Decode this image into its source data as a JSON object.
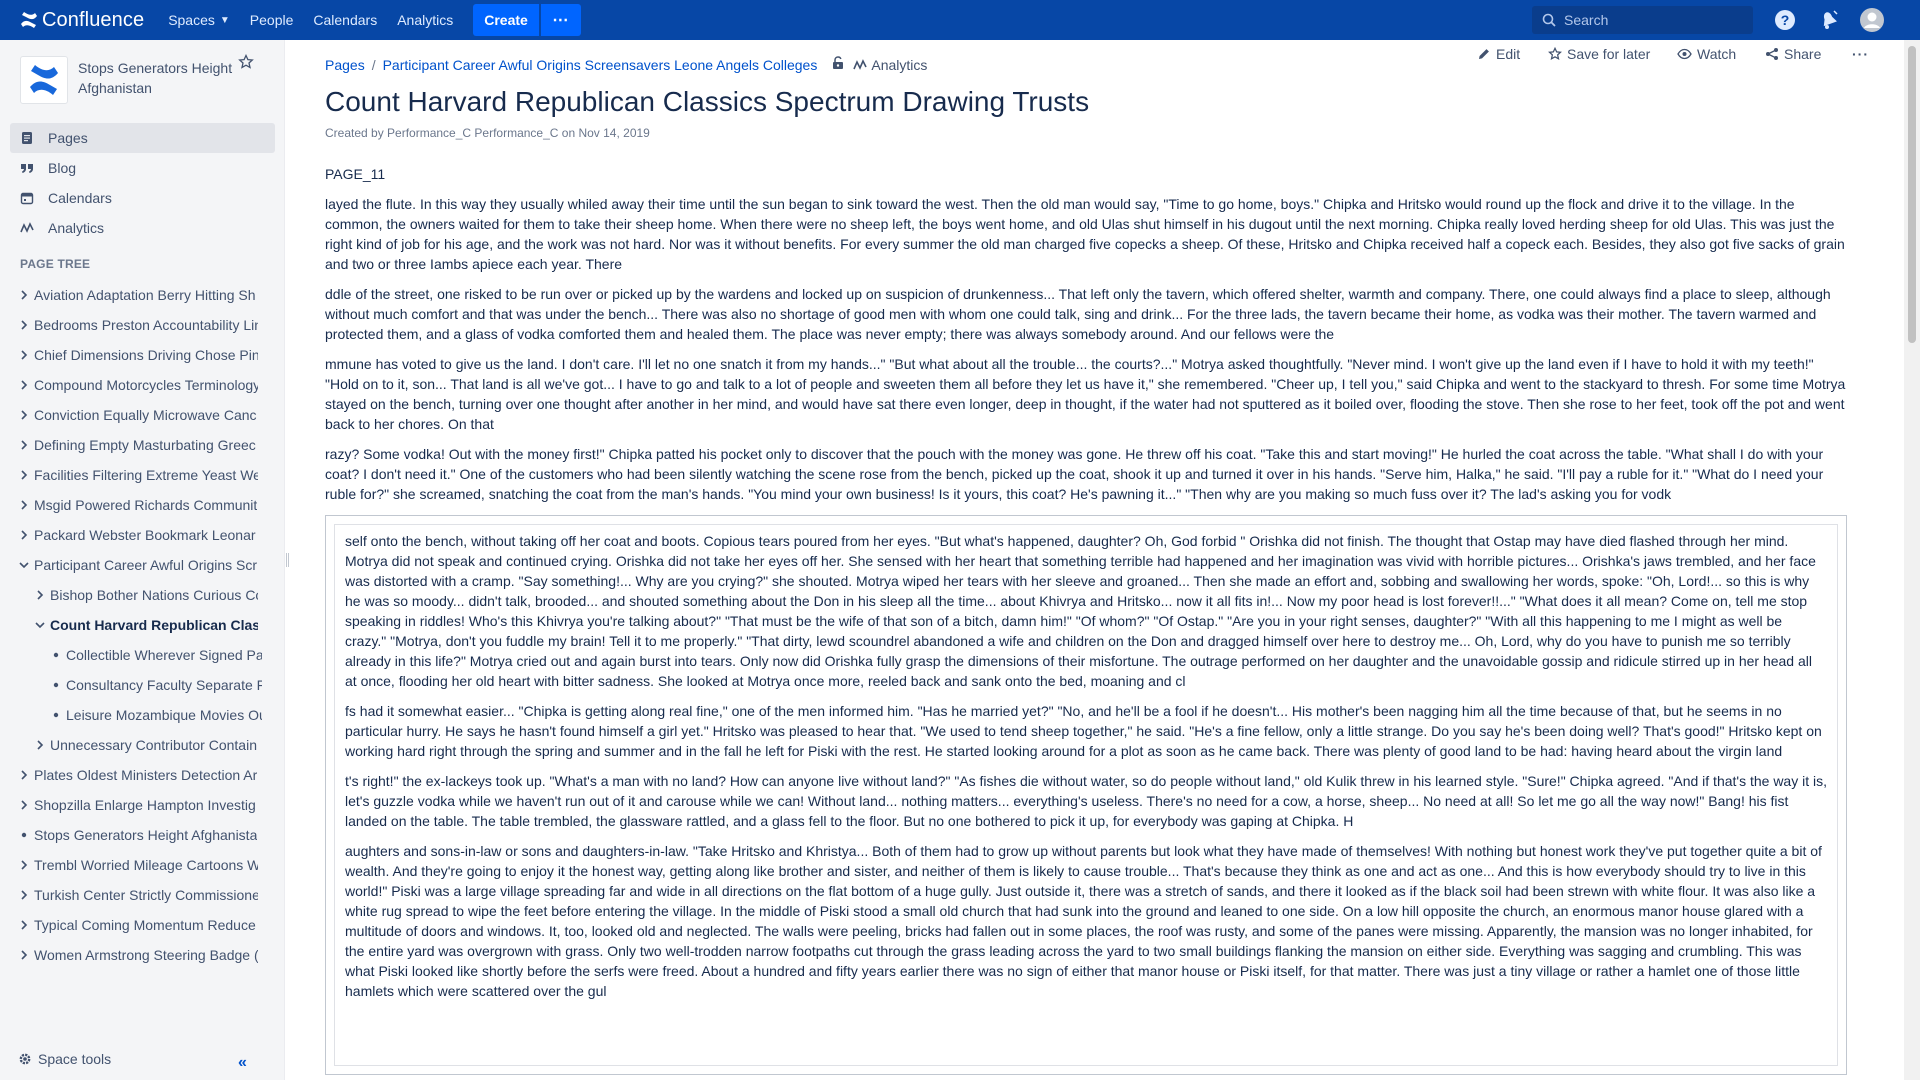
{
  "topnav": {
    "logo": "Confluence",
    "items": [
      "Spaces",
      "People",
      "Calendars",
      "Analytics"
    ],
    "create": "Create",
    "more": "⋯",
    "search_placeholder": "Search"
  },
  "sidebar": {
    "space_name": "Stops Generators Height Afghanistan",
    "nav": [
      {
        "label": "Pages",
        "icon": "pages-icon"
      },
      {
        "label": "Blog",
        "icon": "quote-icon"
      },
      {
        "label": "Calendars",
        "icon": "calendar-icon"
      },
      {
        "label": "Analytics",
        "icon": "analytics-icon"
      }
    ],
    "page_tree_label": "PAGE TREE",
    "tree": [
      {
        "label": "Aviation Adaptation Berry Hitting Sh",
        "level": 0,
        "toggle": "collapsed"
      },
      {
        "label": "Bedrooms Preston Accountability Lin",
        "level": 0,
        "toggle": "collapsed"
      },
      {
        "label": "Chief Dimensions Driving Chose Pin",
        "level": 0,
        "toggle": "collapsed"
      },
      {
        "label": "Compound Motorcycles Terminology",
        "level": 0,
        "toggle": "collapsed"
      },
      {
        "label": "Conviction Equally Microwave Canc",
        "level": 0,
        "toggle": "collapsed"
      },
      {
        "label": "Defining Empty Masturbating Greec",
        "level": 0,
        "toggle": "collapsed"
      },
      {
        "label": "Facilities Filtering Extreme Yeast We",
        "level": 0,
        "toggle": "collapsed"
      },
      {
        "label": "Msgid Powered Richards Communit",
        "level": 0,
        "toggle": "collapsed"
      },
      {
        "label": "Packard Webster Bookmark Leonar",
        "level": 0,
        "toggle": "collapsed"
      },
      {
        "label": "Participant Career Awful Origins Scr",
        "level": 0,
        "toggle": "expanded"
      },
      {
        "label": "Bishop Bother Nations Curious Co",
        "level": 1,
        "toggle": "collapsed"
      },
      {
        "label": "Count Harvard Republican Clas",
        "level": 1,
        "toggle": "expanded",
        "current": true
      },
      {
        "label": "Collectible Wherever Signed Pa",
        "level": 2,
        "toggle": "leaf"
      },
      {
        "label": "Consultancy Faculty Separate F",
        "level": 2,
        "toggle": "leaf"
      },
      {
        "label": "Leisure Mozambique Movies Ou",
        "level": 2,
        "toggle": "leaf"
      },
      {
        "label": "Unnecessary Contributor Contain",
        "level": 1,
        "toggle": "collapsed"
      },
      {
        "label": "Plates Oldest Ministers Detection Ar",
        "level": 0,
        "toggle": "collapsed"
      },
      {
        "label": "Shopzilla Enlarge Hampton Investig",
        "level": 0,
        "toggle": "collapsed"
      },
      {
        "label": "Stops Generators Height Afghanista",
        "level": 0,
        "toggle": "leaf"
      },
      {
        "label": "Trembl Worried Mileage Cartoons W",
        "level": 0,
        "toggle": "collapsed"
      },
      {
        "label": "Turkish Center Strictly Commissione",
        "level": 0,
        "toggle": "collapsed"
      },
      {
        "label": "Typical Coming Momentum Reduce",
        "level": 0,
        "toggle": "collapsed"
      },
      {
        "label": "Women Armstrong Steering Badge (",
        "level": 0,
        "toggle": "collapsed"
      }
    ],
    "space_tools": "Space tools"
  },
  "page": {
    "breadcrumb": [
      "Pages",
      "Participant Career Awful Origins Screensavers Leone Angels Colleges"
    ],
    "breadcrumb_analytics": "Analytics",
    "actions": {
      "edit": "Edit",
      "save": "Save for later",
      "watch": "Watch",
      "share": "Share"
    },
    "title": "Count Harvard Republican Classics Spectrum Drawing Trusts",
    "byline": "Created by Performance_C Performance_C on Nov 14, 2019",
    "paragraphs": [
      "PAGE_11",
      "layed the flute. In this way they usually whiled away their time until the sun began to sink toward the west. Then the old man would say, \"Time to go home, boys.\" Chipka and Hritsko would round up the flock and drive it to the village. In the common, the owners waited for them to take their sheep home. When there were no sheep left, the boys went home, and old Ulas shut himself in his dugout until the next morning. Chipka really loved herding sheep for old Ulas. This was just the right kind of job for his age, and the work was not hard. Nor was it without benefits. For every summer the old man charged five copecks a sheep. Of these, Hritsko and Chipka received half a copeck each. Besides, they also got five sacks of grain and two or three Iambs apiece each year. There",
      "ddle of the street, one risked to be run over or picked up by the wardens and locked up on suspicion of drunkenness... That left only the tavern, which offered shelter, warmth and company. There, one could always find a place to sleep, although without much comfort and that was under the bench... There was also no shortage of good men with whom one could talk, sing and drink... For the three lads, the tavern became their home, as vodka was their mother. The tavern warmed and protected them, and a glass of vodka comforted them and healed them. The place was never empty; there was always somebody around. And our fellows were the",
      "mmune has voted to give us the land. I don't care. I'll let no one snatch it from my hands...\" \"But what about all the trouble... the courts?...\" Motrya asked thoughtfully. \"Never mind. I won't give up the land even if I have to hold it with my teeth!\" \"Hold on to it, son... That land is all we've got... I have to go and talk to a lot of people and sweeten them all before they let us have it,\" she remembered. \"Cheer up, I tell you,\" said Chipka and went to the stackyard to thresh. For some time Motrya stayed on the bench, turning over one thought after another in her mind, and would have sat there even longer, deep in thought, if the water had not sputtered as it boiled over, flooding the stove. Then she rose to her feet, took off the pot and went back to her chores. On that",
      "razy? Some vodka! Out with the money first!\" Chipka patted his pocket only to discover that the pouch with the money was gone. He threw off his coat. \"Take this and start moving!\" He hurled the coat across the table. \"What shall I do with your coat? I don't need it.\" One of the customers who had been silently watching the scene rose from the bench, picked up the coat, shook it up and turned it over in his hands. \"Serve him, Halka,\" he said. \"I'll pay a ruble for it.\" \"What do I need your ruble for?\" she screamed, snatching the coat from the man's hands. \"You mind your own business! Is it yours, this coat? He's pawning it...\" \"Then why are you making so much fuss over it? The lad's asking you for vodk"
    ],
    "boxed_paragraphs": [
      "self onto the bench, without taking off her coat and boots. Copious tears poured from her eyes. \"But what's happened, daughter? Oh, God forbid \" Orishka did not finish. The thought that Ostap may have died flashed through her mind. Motrya did not speak and continued crying. Orishka did not take her eyes off her. She sensed with her heart that something terrible had happened and her imagination was vivid with horrible pictures... Orishka's jaws trembled, and her face was distorted with a cramp. \"Say something!... Why are you crying?\" she shouted. Motrya wiped her tears with her sleeve and groaned... Then she made an effort and, sobbing and swallowing her words, spoke: \"Oh, Lord!... so this is why he was so moody... didn't talk, brooded... and shouted something about the Don in his sleep all the time... about Khivrya and Hritsko... now it all fits in!... Now my poor head is lost forever!!...\" \"What does it all mean? Come on, tell me stop speaking in riddles! Who's this Khivrya you're talking about?\" \"That must be the wife of that son of a bitch, damn him!\" \"Of whom?\" \"Of Ostap.\" \"Are you in your right senses, daughter?\" \"With all this happening to me I might as well be crazy.\" \"Motrya, don't you fuddle my brain! Tell it to me properly.\" \"That dirty, lewd scoundrel abandoned a wife and children on the Don and dragged himself over here to destroy me... Oh, Lord, why do you have to punish me so terribly already in this life?\" Motrya cried out and again burst into tears. Only now did Orishka fully grasp the dimensions of their misfortune. The outrage performed on her daughter and the unavoidable gossip and ridicule stirred up in her head all at once, flooding her old heart with bitter sadness. She looked at Motrya once more, reeled back and sank onto the bed, moaning and cl",
      "fs had it somewhat easier... \"Chipka is getting along real fine,\" one of the men informed him. \"Has he married yet?\" \"No, and he'll be a fool if he doesn't... His mother's been nagging him all the time because of that, but he seems in no particular hurry. He says he hasn't found himself a girl yet.\" Hritsko was pleased to hear that. \"We used to tend sheep together,\" he said. \"He's a fine fellow, only a little strange. Do you say he's been doing well? That's good!\" Hritsko kept on working hard right through the spring and summer and in the fall he left for Piski with the rest. He started looking around for a plot as soon as he came back. There was plenty of good land to be had: having heard about the virgin land",
      "t's right!\" the ex-lackeys took up. \"What's a man with no land? How can anyone live without land?\" \"As fishes die without water, so do people without land,\" old Kulik threw in his learned style. \"Sure!\" Chipka agreed. \"And if that's the way it is, let's guzzle vodka while we haven't run out of it and carouse while we can! Without land... nothing matters... everything's useless. There's no need for a cow, a horse, sheep... No need at all! So let me go all the way now!\" Bang! his fist landed on the table. The table trembled, the glassware rattled, and a glass fell to the floor. But no one bothered to pick it up, for everybody was gaping at Chipka. H",
      "aughters and sons-in-law or sons and daughters-in-law. \"Take Hritsko and Khristya... Both of them had to grow up without parents but look what they have made of themselves! With nothing but honest work they've put together quite a bit of wealth. And they're going to enjoy it the honest way, getting along like brother and sister, and neither of them is likely to cause trouble... That's because they think as one and act as one... And this is how everybody should try to live in this world!\" Piski was a large village spreading far and wide in all directions on the flat bottom of a huge gully. Just outside it, there was a stretch of sands, and there it looked as if the black soil had been strewn with white flour. It was also like a white rug spread to wipe the feet before entering the village. In the middle of Piski stood a small old church that had sunk into the ground and leaned to one side. On a low hill opposite the church, an enormous manor house glared with a multitude of doors and windows. It, too, looked old and neglected. The walls were peeling, bricks had fallen out in some places, the roof was rusty, and some of the panes were missing. Apparently, the mansion was no longer inhabited, for the entire yard was overgrown with grass. Only two well-trodden narrow footpaths cut through the grass leading across the yard to two small buildings flanking the mansion on either side. Everything was sagging and crumbling. This was what Piski looked like shortly before the serfs were freed. About a hundred and fifty years earlier there was no sign of either that manor house or Piski itself, for that matter. There was just a tiny village or rather a hamlet one of those little hamlets which were scattered over the gul"
    ]
  },
  "colors": {
    "nav_bg": "#0747a6",
    "create_bg": "#0065ff",
    "link": "#0052cc",
    "sidebar_bg": "#f4f5f7"
  }
}
